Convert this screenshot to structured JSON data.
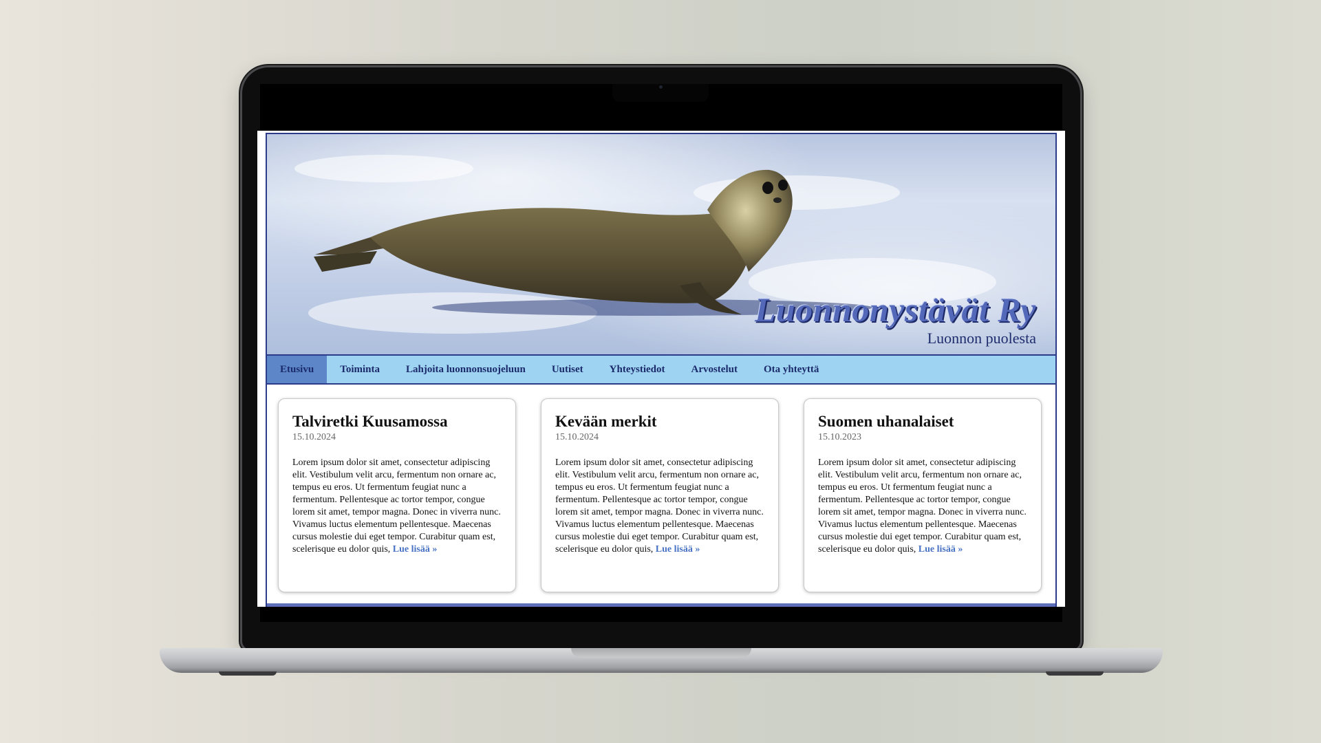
{
  "site": {
    "title": "Luonnonystävät Ry",
    "tagline": "Luonnon puolesta"
  },
  "nav": {
    "items": [
      {
        "label": "Etusivu",
        "active": true
      },
      {
        "label": "Toiminta",
        "active": false
      },
      {
        "label": "Lahjoita luonnonsuojeluun",
        "active": false
      },
      {
        "label": "Uutiset",
        "active": false
      },
      {
        "label": "Yhteystiedot",
        "active": false
      },
      {
        "label": "Arvostelut",
        "active": false
      },
      {
        "label": "Ota yhteyttä",
        "active": false
      }
    ]
  },
  "articles": [
    {
      "title": "Talviretki Kuusamossa",
      "date": "15.10.2024",
      "text": "Lorem ipsum dolor sit amet, consectetur adipiscing elit. Vestibulum velit arcu, fermentum non ornare ac, tempus eu eros. Ut fermentum feugiat nunc a fermentum. Pellentesque ac tortor tempor, congue lorem sit amet, tempor magna. Donec in viverra nunc. Vivamus luctus elementum pellentesque. Maecenas cursus molestie dui eget tempor. Curabitur quam est, scelerisque eu dolor quis, ",
      "read_more": "Lue lisää »"
    },
    {
      "title": "Kevään merkit",
      "date": "15.10.2024",
      "text": "Lorem ipsum dolor sit amet, consectetur adipiscing elit. Vestibulum velit arcu, fermentum non ornare ac, tempus eu eros. Ut fermentum feugiat nunc a fermentum. Pellentesque ac tortor tempor, congue lorem sit amet, tempor magna. Donec in viverra nunc. Vivamus luctus elementum pellentesque. Maecenas cursus molestie dui eget tempor. Curabitur quam est, scelerisque eu dolor quis, ",
      "read_more": "Lue lisää »"
    },
    {
      "title": "Suomen uhanalaiset",
      "date": "15.10.2023",
      "text": "Lorem ipsum dolor sit amet, consectetur adipiscing elit. Vestibulum velit arcu, fermentum non ornare ac, tempus eu eros. Ut fermentum feugiat nunc a fermentum. Pellentesque ac tortor tempor, congue lorem sit amet, tempor magna. Donec in viverra nunc. Vivamus luctus elementum pellentesque. Maecenas cursus molestie dui eget tempor. Curabitur quam est, scelerisque eu dolor quis, ",
      "read_more": "Lue lisää »"
    }
  ],
  "colors": {
    "nav_bg": "#9fd3f2",
    "nav_active": "#5d86c8",
    "border": "#2c3a8a",
    "link": "#4872c4",
    "title": "#5368b8"
  },
  "hero_image": "seal-on-ice-photo"
}
